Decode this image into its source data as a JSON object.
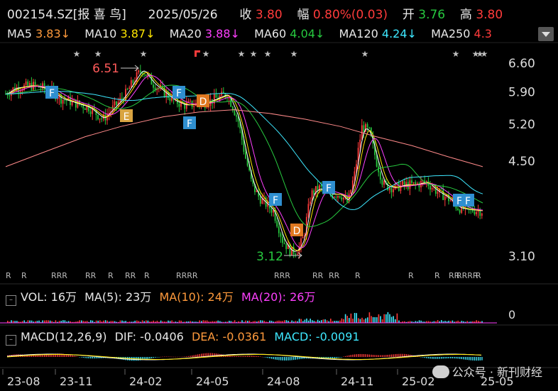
{
  "header": {
    "code": "002154.SZ[报 喜 鸟]",
    "date": "2025/05/26",
    "close_label": "收",
    "close": "3.80",
    "change_label": "幅",
    "change": "0.80%(0.03)",
    "open_label": "开",
    "open": "3.76",
    "high_label": "高",
    "high": "3.80"
  },
  "ma_bar": [
    {
      "label": "MA5",
      "value": "3.83↓",
      "color": "#ff9a3c"
    },
    {
      "label": "MA10",
      "value": "3.87↓",
      "color": "#ffe600"
    },
    {
      "label": "MA20",
      "value": "3.88↓",
      "color": "#ff40ff"
    },
    {
      "label": "MA60",
      "value": "4.04↓",
      "color": "#27c93f"
    },
    {
      "label": "MA120",
      "value": "4.24↓",
      "color": "#3ee8ff"
    },
    {
      "label": "MA250",
      "value": "4.3",
      "color": "#ff5a5a"
    }
  ],
  "price_axis": [
    "6.60",
    "5.90",
    "5.20",
    "4.50",
    "3.10"
  ],
  "annotations": {
    "high": "6.51",
    "low": "3.12"
  },
  "markers": {
    "F": [
      [
        73,
        130
      ],
      [
        252,
        130
      ],
      [
        267,
        173
      ],
      [
        388,
        281
      ],
      [
        463,
        264
      ],
      [
        647,
        282
      ],
      [
        659,
        282
      ]
    ],
    "E": [
      [
        178,
        163
      ]
    ],
    "D": [
      [
        286,
        142
      ],
      [
        418,
        324
      ]
    ]
  },
  "date_axis": [
    "23-08",
    "23-11",
    "24-02",
    "24-05",
    "24-08",
    "24-11",
    "25-02",
    "25-05"
  ],
  "volume": {
    "label": "VOL: 16万",
    "ma5": "MA(5): 23万",
    "ma10": "MA(10): 24万",
    "ma20": "MA(20): 26万",
    "axis": "0"
  },
  "macd": {
    "label": "MACD(12,26,9)",
    "dif": "DIF: -0.0406",
    "dea": "DEA: -0.0361",
    "macd": "MACD: -0.0091"
  },
  "watermark": "公众号 · 新刊财经",
  "colors": {
    "up": "#ff3b3b",
    "down": "#27c93f",
    "F": "#2f8fd0",
    "E": "#d9a441",
    "D": "#e07820"
  }
}
